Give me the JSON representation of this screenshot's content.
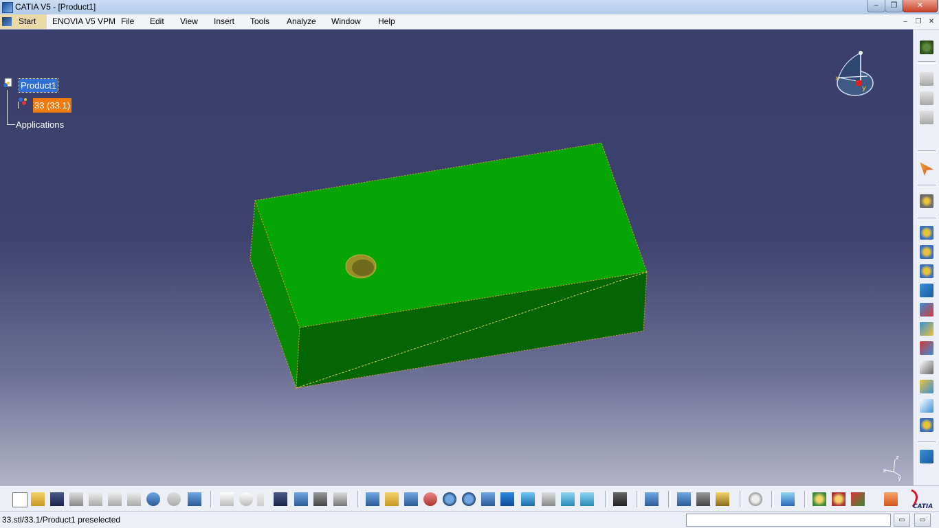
{
  "window": {
    "title": "CATIA V5 - [Product1]",
    "controls": {
      "minimize": "–",
      "maximize": "❐",
      "close": "✕"
    }
  },
  "menubar": {
    "items": [
      "Start",
      "ENOVIA V5 VPM",
      "File",
      "Edit",
      "View",
      "Insert",
      "Tools",
      "Analyze",
      "Window",
      "Help"
    ],
    "doc_controls": {
      "minimize": "–",
      "restore": "❐",
      "close": "✕"
    }
  },
  "tree": {
    "root": "Product1",
    "part": "33 (33.1)",
    "applications": "Applications"
  },
  "compass": {
    "x": "x",
    "y": "y"
  },
  "axis_triad": {
    "x": "x",
    "y": "y",
    "z": "z"
  },
  "brand": {
    "logo_text": "CATIA"
  },
  "status": {
    "message": "33.stl/33.1/Product1 preselected",
    "command_input": ""
  },
  "colors": {
    "part_top": "#04a504",
    "part_front": "#036503",
    "part_side": "#068a06",
    "selection_blue": "#2f6fd6",
    "selection_orange": "#f07c10"
  }
}
